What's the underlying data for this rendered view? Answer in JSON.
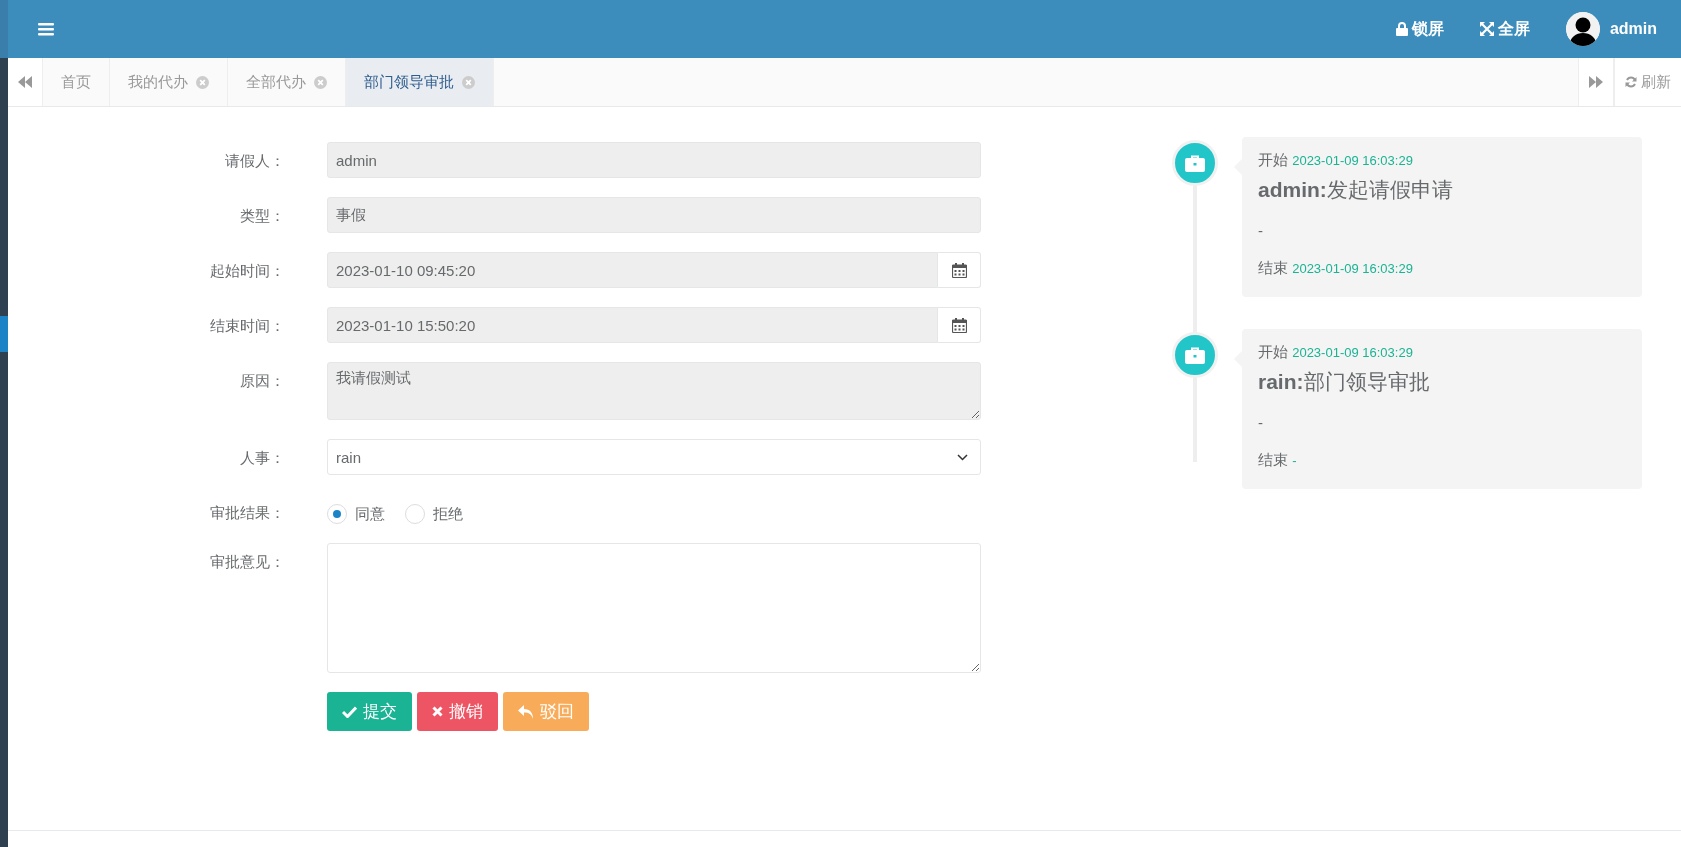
{
  "header": {
    "lock": "锁屏",
    "fullscreen": "全屏",
    "user": "admin"
  },
  "tabs": [
    {
      "label": "首页",
      "closable": false,
      "selected": false
    },
    {
      "label": "我的代办",
      "closable": true,
      "selected": false
    },
    {
      "label": "全部代办",
      "closable": true,
      "selected": false
    },
    {
      "label": "部门领导审批",
      "closable": true,
      "selected": true
    }
  ],
  "refresh": "刷新",
  "form": {
    "fields": [
      {
        "kind": "text",
        "label": "请假人：",
        "value": "admin",
        "readonly": true
      },
      {
        "kind": "text",
        "label": "类型：",
        "value": "事假",
        "readonly": true
      },
      {
        "kind": "date",
        "label": "起始时间：",
        "value": "2023-01-10 09:45:20",
        "readonly": true
      },
      {
        "kind": "date",
        "label": "结束时间：",
        "value": "2023-01-10 15:50:20",
        "readonly": true
      },
      {
        "kind": "textarea",
        "label": "原因：",
        "value": "我请假测试",
        "readonly": true
      },
      {
        "kind": "select",
        "label": "人事：",
        "value": "rain"
      },
      {
        "kind": "radio",
        "label": "审批结果：",
        "options": [
          {
            "label": "同意",
            "selected": true
          },
          {
            "label": "拒绝",
            "selected": false
          }
        ]
      },
      {
        "kind": "comment",
        "label": "审批意见：",
        "readonly": false
      }
    ],
    "buttons": [
      {
        "kind": "submit",
        "label": "提交"
      },
      {
        "kind": "cancel",
        "label": "撤销"
      },
      {
        "kind": "reject",
        "label": "驳回"
      }
    ]
  },
  "timeline": [
    {
      "start_label": "开始",
      "start_time": "2023-01-09 16:03:29",
      "title": "**admin:**发起请假申请",
      "comment": "-",
      "end_label": "结束",
      "end_time": "2023-01-09 16:03:29"
    },
    {
      "start_label": "开始",
      "start_time": "2023-01-09 16:03:29",
      "title": "**rain:**部门领导审批",
      "comment": "-",
      "end_label": "结束",
      "end_time": "-"
    }
  ]
}
